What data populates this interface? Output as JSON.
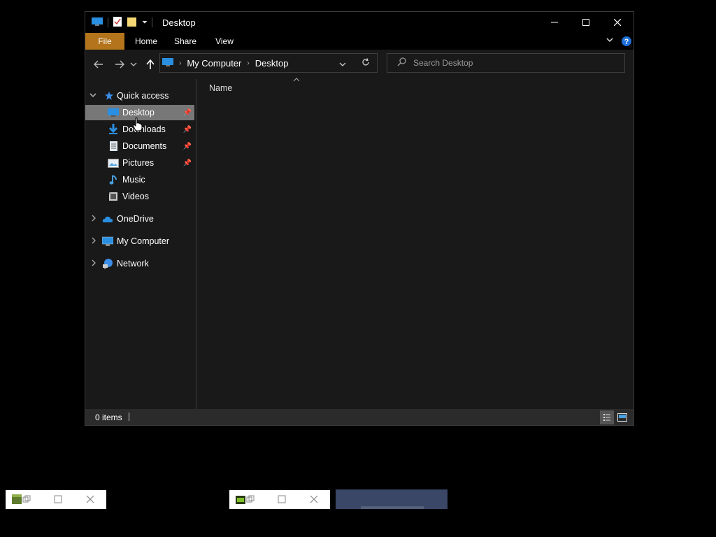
{
  "window": {
    "title": "Desktop",
    "ribbon_tabs": [
      "File",
      "Home",
      "Share",
      "View"
    ]
  },
  "address": {
    "crumbs": [
      "My Computer",
      "Desktop"
    ]
  },
  "search": {
    "placeholder": "Search Desktop"
  },
  "sidebar": {
    "quick_access": "Quick access",
    "items": [
      {
        "label": "Desktop",
        "icon": "desktop-icon",
        "pinned": true,
        "selected": true
      },
      {
        "label": "Downloads",
        "icon": "downloads-icon",
        "pinned": true
      },
      {
        "label": "Documents",
        "icon": "documents-icon",
        "pinned": true
      },
      {
        "label": "Pictures",
        "icon": "pictures-icon",
        "pinned": true
      },
      {
        "label": "Music",
        "icon": "music-icon",
        "pinned": false
      },
      {
        "label": "Videos",
        "icon": "videos-icon",
        "pinned": false
      }
    ],
    "roots": [
      {
        "label": "OneDrive",
        "icon": "onedrive-icon"
      },
      {
        "label": "My Computer",
        "icon": "computer-icon"
      },
      {
        "label": "Network",
        "icon": "network-icon"
      }
    ]
  },
  "content": {
    "column_name": "Name"
  },
  "status": {
    "items_text": "0 items"
  },
  "colors": {
    "accent_file_tab": "#b3741c",
    "selected_bg": "#777777",
    "help_blue": "#1e6fd9"
  }
}
